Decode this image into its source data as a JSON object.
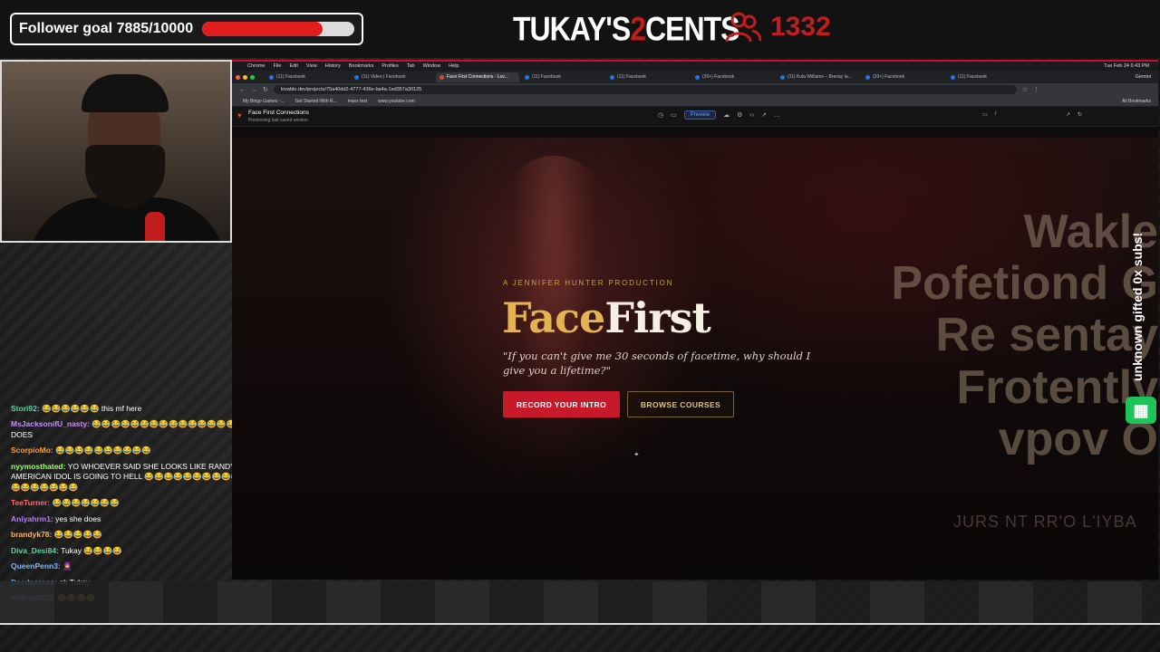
{
  "overlay": {
    "follower_goal": "Follower goal 7885/10000",
    "follower_progress": 0.7885,
    "brand_left": "TUKAY'S",
    "brand_mid": "2",
    "brand_right": "CENTS",
    "viewer_count": "1332",
    "sub_banner": "unknown gifted 0x subs!"
  },
  "chat": [
    {
      "user": "Stori92:",
      "text": "😂😂😂😂😂😂 this mf here",
      "color": "#5fd39a"
    },
    {
      "user": "MsJacksonifU_nasty:",
      "text": "😂😂😂😂😂😂😂😂😂😂😂😂😂😂😂😂😂SHE DOES",
      "color": "#c98bff"
    },
    {
      "user": "ScorpioMo:",
      "text": "😂😂😂😂😂😂😂😂😂😂",
      "color": "#ff9d3b"
    },
    {
      "user": "nyymosthated:",
      "text": "YO WHOEVER SAID SHE LOOKS LIKE RANDY FROM AMERICAN IDOL IS GOING TO HELL 😂😂😂😂😂😂😂😂😂😂😂😂😂😂😂😂😂😂😂😂😂",
      "color": "#9cff6a"
    },
    {
      "user": "TeeTurner:",
      "text": "😂😂😂😂😂😂😂",
      "color": "#ff6b6b"
    },
    {
      "user": "Aniyahrm1:",
      "text": "yes she does",
      "color": "#b57cff"
    },
    {
      "user": "brandyk78:",
      "text": "😂😂😂😂😂",
      "color": "#ffb35c"
    },
    {
      "user": "Diva_Desi84:",
      "text": "Tukay 😂😂😂😂",
      "color": "#5fd39a"
    },
    {
      "user": "QueenPenn3:",
      "text": "🧕",
      "color": "#7ab8ff"
    },
    {
      "user": "Deedeerene:",
      "text": "ok Tukay",
      "color": "#5fa8ff"
    },
    {
      "user": "Melinda225:",
      "text": "😂😂😂😂",
      "color": "#b57cff"
    }
  ],
  "browser": {
    "menubar": [
      "Chrome",
      "File",
      "Edit",
      "View",
      "History",
      "Bookmarks",
      "Profiles",
      "Tab",
      "Window",
      "Help"
    ],
    "datetime": "Tue Feb 24  6:43 PM",
    "tabs": [
      {
        "label": "(11) Facebook"
      },
      {
        "label": "(11) Video | Facebook"
      },
      {
        "label": "Face First Connections - Lov..."
      },
      {
        "label": "(11) Facebook"
      },
      {
        "label": "(11) Facebook"
      },
      {
        "label": "(20+) Facebook"
      },
      {
        "label": "(11) Kula Williams – Brenay la..."
      },
      {
        "label": "(20+) Facebook"
      },
      {
        "label": "(11) Facebook"
      }
    ],
    "gemini": "Gemini",
    "url": "lovable.dev/projects/75a40dd2-4777-436e-ba4a-1ed357a30125",
    "bookmarks": [
      "My Bingo Games -...",
      "Get Started With R...",
      "maxx test",
      "www.youtube.com"
    ],
    "all_bookmarks": "All Bookmarks"
  },
  "lovable": {
    "project": "Face First Connections",
    "status": "Previewing last saved version",
    "preview": "Preview",
    "path": "/"
  },
  "hero": {
    "kicker": "A JENNIFER HUNTER PRODUCTION",
    "headline_a": "Face",
    "headline_b": "First",
    "tagline": "\"If you can't give me 30 seconds of facetime, why should I give you a lifetime?\"",
    "primary_cta": "RECORD YOUR INTRO",
    "secondary_cta": "BROWSE COURSES",
    "bg_line1": "Wakle",
    "bg_line2": "Pofetiond G",
    "bg_line3": "Re sentay",
    "bg_line4": "Frotently",
    "bg_line5": "vpov  O",
    "bg_small": "JURS NT RR'O L'IYBA"
  }
}
